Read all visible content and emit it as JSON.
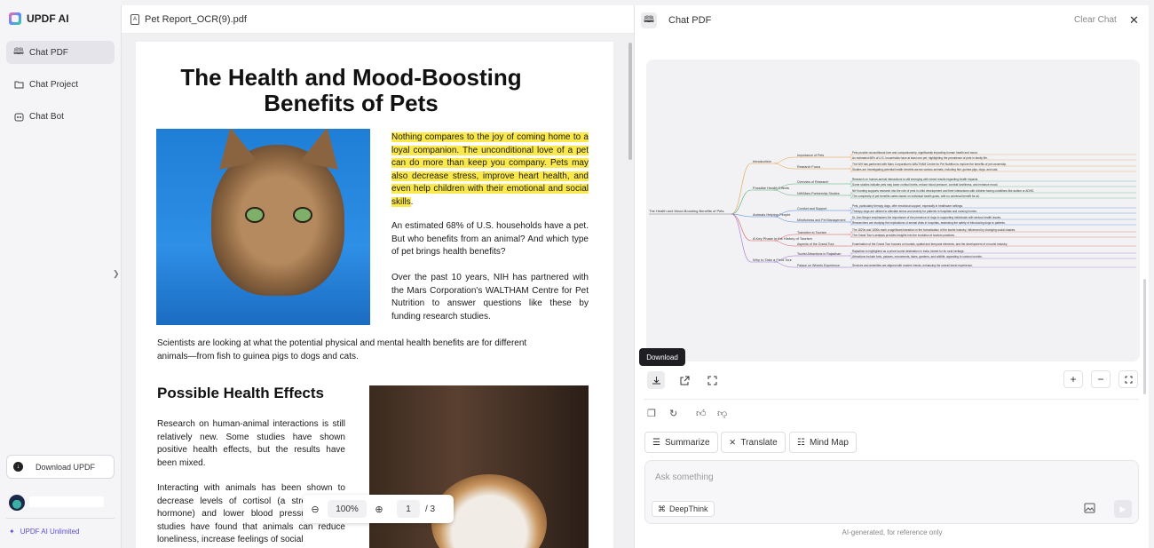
{
  "app": {
    "name": "UPDF AI"
  },
  "sidebar": {
    "items": [
      {
        "label": "Chat PDF",
        "icon": "book-icon",
        "active": true
      },
      {
        "label": "Chat Project",
        "icon": "folder-icon",
        "active": false
      },
      {
        "label": "Chat Bot",
        "icon": "bot-icon",
        "active": false
      }
    ],
    "download_label": "Download UPDF",
    "unlimited_label": "UPDF AI Unlimited"
  },
  "document": {
    "filename": "Pet Report_OCR(9).pdf",
    "title_line1": "The Health and Mood-Boosting",
    "title_line2": "Benefits of Pets",
    "highlight_para": "Nothing compares to the joy of coming home to a loyal companion. The unconditional love of a pet can do more than keep you company. Pets may also decrease stress, improve heart health, and even help children with their emotional and social skills",
    "highlight_end": ".",
    "para2": "An estimated 68% of U.S. households have a pet. But who benefits from an animal? And which type of pet brings health benefits?",
    "para3": "Over the past 10 years, NIH has partnered with the Mars Corporation's WALTHAM Centre for Pet Nutrition to answer questions like these by funding research studies.",
    "para4": "Scientists are looking at what the potential physical and mental health benefits are for different animals—from fish to guinea pigs to dogs and cats.",
    "heading2": "Possible Health Effects",
    "para5": "Research on human-animal interactions is still relatively new. Some studies have shown positive health effects, but the results have been mixed.",
    "para6": "Interacting with animals has been shown to decrease levels of cortisol (a stress-related hormone) and lower blood pressure. Other studies have found that animals can reduce loneliness, increase feelings of social"
  },
  "viewer": {
    "zoom": "100%",
    "page": "1",
    "total": "/ 3"
  },
  "chat": {
    "title": "Chat PDF",
    "clear_label": "Clear Chat",
    "tooltip": "Download",
    "actions": {
      "summarize": "Summarize",
      "translate": "Translate",
      "mindmap": "Mind Map"
    },
    "input_placeholder": "Ask something",
    "deepthink_label": "DeepThink",
    "footnote": "AI-generated, for reference only"
  },
  "mindmap": {
    "root": "The Health and Mood-Boosting Benefits of Pets",
    "branches": [
      {
        "label": "Introduction",
        "children": [
          {
            "label": "Importance of Pets",
            "leaves": [
              "Pets provide unconditional love and companionship, significantly impacting human health and mood.",
              "An estimated 68% of U.S. households have at least one pet, highlighting the prevalence of pets in family life."
            ]
          },
          {
            "label": "Research Focus",
            "leaves": [
              "The NIH has partnered with Mars Corporation's WALTHAM Centre for Pet Nutrition to explore the benefits of pet ownership.",
              "Studies are investigating potential health benefits across various animals, including fish, guinea pigs, dogs, and cats."
            ]
          }
        ]
      },
      {
        "label": "Possible Health Effects",
        "children": [
          {
            "label": "Overview of Research",
            "leaves": [
              "Research on human-animal interactions is still emerging with mixed results regarding health impacts.",
              "Some studies indicate pets may lower cortisol levels, reduce blood pressure, combat loneliness, and enhance mood."
            ]
          },
          {
            "label": "NIH/Mars Partnership Studies",
            "leaves": [
              "NIH funding supports research into the role of pets in child development and their interactions with children facing conditions like autism or ADHD.",
              "The complexity of pet benefits varies based on individual health goals, with no universal benefit for all."
            ]
          }
        ]
      },
      {
        "label": "Animals Helping People",
        "children": [
          {
            "label": "Comfort and Support",
            "leaves": [
              "Pets, particularly therapy dogs, offer emotional support, especially in healthcare settings.",
              "Therapy dogs are utilized to alleviate stress and anxiety for patients in hospitals and nursing homes."
            ]
          },
          {
            "label": "Mindfulness and Pet Management",
            "leaves": [
              "Dr. Ann Berger emphasizes the importance of the presence of dogs in supporting individuals with serious health issues.",
              "Researchers are studying the implications of animal visits in hospitals, assessing the safety of introducing dogs to patients."
            ]
          }
        ]
      },
      {
        "label": "A Key Phase in the History of Tourism",
        "children": [
          {
            "label": "Transition to Tourism",
            "leaves": [
              "The 1820s and 1830s mark a significant transition in the formalization of the tourist industry, influenced by changing social classes.",
              "The Grand Tour's analysis provides insights into the evolution of tourism practices."
            ]
          },
          {
            "label": "Aspects of the Grand Tour",
            "leaves": [
              "Examination of the Grand Tour focuses on tourists, spatial and temporal elements, and the development of a tourist industry."
            ]
          }
        ]
      },
      {
        "label": "Why to Take a Field Tour",
        "children": [
          {
            "label": "Tourist Attractions in Rajasthan",
            "leaves": [
              "Rajasthan is highlighted as a prime tourist destination in India, famed for its rural heritage.",
              "Attractions include forts, palaces, monuments, lakes, gardens, and wildlife, appealing to various tourists."
            ]
          },
          {
            "label": "Palace on Wheels Experience",
            "leaves": [
              "Services and amenities are aligned with modern trends, enhancing the overall travel experience."
            ]
          }
        ]
      }
    ],
    "colors": [
      "#e69a3c",
      "#4caf70",
      "#4a7fe0",
      "#d65a5a",
      "#9a6ad6"
    ]
  }
}
